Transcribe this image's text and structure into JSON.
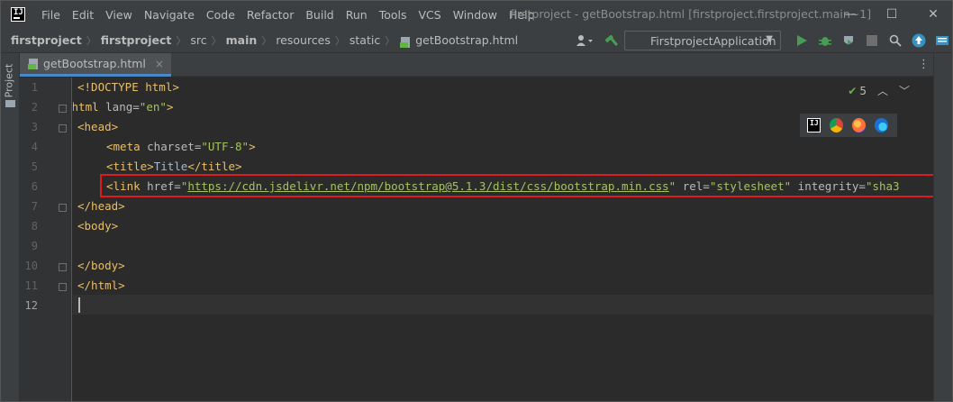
{
  "app": {
    "logo_text": "IJ",
    "window_title": "firstproject - getBootstrap.html [firstproject.firstproject.main~1]",
    "menu": [
      "File",
      "Edit",
      "View",
      "Navigate",
      "Code",
      "Refactor",
      "Build",
      "Run",
      "Tools",
      "VCS",
      "Window",
      "Help"
    ],
    "controls": {
      "minimize": "—",
      "maximize": "☐",
      "close": "✕"
    }
  },
  "breadcrumbs": [
    "firstproject",
    "firstproject",
    "src",
    "main",
    "resources",
    "static",
    "getBootstrap.html"
  ],
  "toolbar": {
    "run_config": "FirstprojectApplication",
    "icons": [
      "user-icon",
      "build-hammer-icon",
      "run-icon",
      "debug-icon",
      "coverage-icon",
      "stop-icon",
      "search-icon",
      "update-icon",
      "settings-icon"
    ]
  },
  "side": {
    "project_tab": "Project"
  },
  "editor": {
    "tab_label": "getBootstrap.html",
    "tab_close": "×",
    "inspections": "5",
    "line_numbers": [
      "1",
      "2",
      "3",
      "4",
      "5",
      "6",
      "7",
      "8",
      "9",
      "10",
      "11",
      "12"
    ],
    "lines": {
      "l1": "<!DOCTYPE html>",
      "l2_open": "<html ",
      "l2_attr": "lang=",
      "l2_val": "\"en\"",
      "l2_close": ">",
      "l3": "<head>",
      "l4_open": "<meta ",
      "l4_attr": "charset=",
      "l4_val": "\"UTF-8\"",
      "l4_close": ">",
      "l5_open": "<title>",
      "l5_text": "Title",
      "l5_close": "</title>",
      "l6_open": "<link ",
      "l6_attr1": "href=",
      "l6_q1": "\"",
      "l6_url": "https://cdn.jsdelivr.net/npm/bootstrap@5.1.3/dist/css/bootstrap.min.css",
      "l6_q2": "\" ",
      "l6_attr2": "rel=",
      "l6_val2": "\"stylesheet\" ",
      "l6_attr3": "integrity=",
      "l6_val3": "\"sha3",
      "l7": "</head>",
      "l8": "<body>",
      "l10": "</body>",
      "l11": "</html>"
    }
  },
  "browsers": [
    "intellij-icon",
    "chrome-icon",
    "firefox-icon",
    "edge-icon"
  ],
  "colors": {
    "highlight": "#e0191e",
    "accent": "#4a88c7"
  }
}
